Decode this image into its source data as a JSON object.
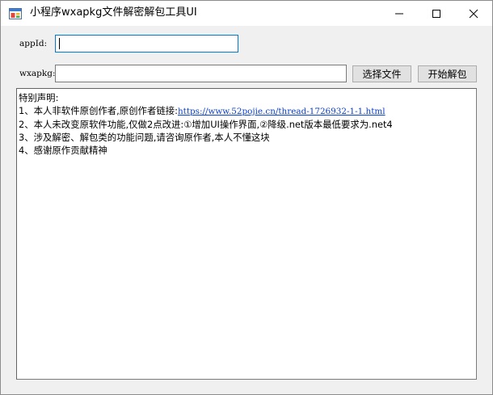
{
  "window": {
    "title": "小程序wxapkg文件解密解包工具UI"
  },
  "form": {
    "appid_label": "appId:",
    "appid_value": "",
    "wxapkg_label": "wxapkg:",
    "wxapkg_value": "",
    "choose_file_label": "选择文件",
    "start_unpack_label": "开始解包"
  },
  "log": {
    "line1": "特别声明:",
    "line2_prefix": "1、本人非软件原创作者,原创作者链接:",
    "line2_link": "https://www.52pojie.cn/thread-1726932-1-1.html",
    "line3": "2、本人未改变原软件功能,仅做2点改进:①增加UI操作界面,②降级.net版本最低要求为.net4",
    "line4": "3、涉及解密、解包类的功能问题,请咨询原作者,本人不懂这块",
    "line5": "4、感谢原作贡献精神"
  },
  "icons": {
    "app": "app-window-icon",
    "minimize": "minimize-icon",
    "maximize": "maximize-icon",
    "close": "close-icon"
  },
  "colors": {
    "focus_border": "#0078d7",
    "link": "#0b40cc",
    "button_face": "#e1e1e1"
  }
}
